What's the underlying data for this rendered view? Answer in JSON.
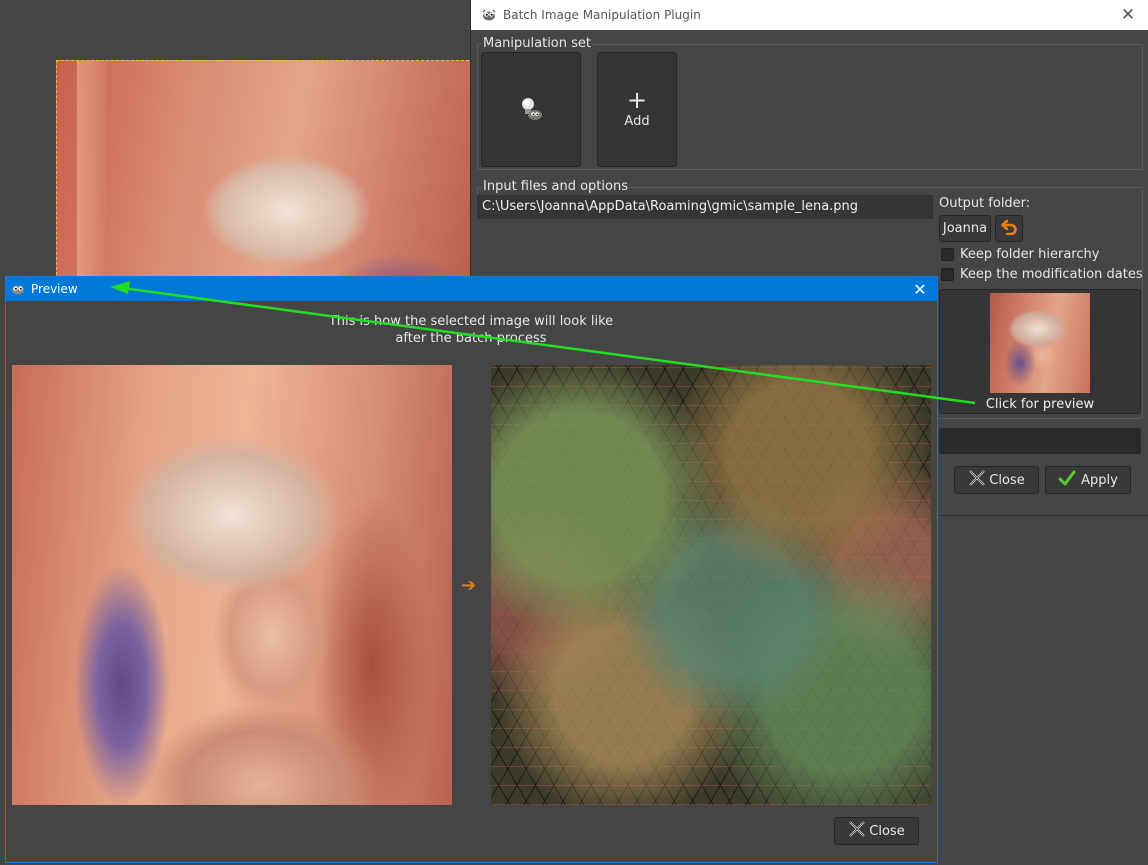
{
  "bimp": {
    "title": "Batch Image Manipulation Plugin",
    "close_glyph": "✕",
    "manipulation_set_label": "Manipulation set",
    "add_glyph": "+",
    "add_label": "Add",
    "input_files_label": "Input files and options",
    "files": [
      "C:\\Users\\Joanna\\AppData\\Roaming\\gmic\\sample_lena.png"
    ],
    "output_folder_label": "Output folder:",
    "output_folder_value": "Joanna",
    "keep_hierarchy_label": "Keep folder hierarchy",
    "keep_dates_label": "Keep the modification dates",
    "preview_label": "Click for preview",
    "close_button": "Close",
    "apply_button": "Apply"
  },
  "preview": {
    "title": "Preview",
    "close_glyph": "✕",
    "caption_line1": "This is how the selected image will look like",
    "caption_line2": "after the batch process",
    "arrow_glyph": "➔",
    "close_button": "Close"
  },
  "colors": {
    "accent_blue": "#0078d7",
    "annotation_green": "#22dd22",
    "apply_check": "#5ac92f",
    "arrow_orange": "#e87d16"
  },
  "icons": [
    "gimp-icon",
    "bulb-icon",
    "plus-icon",
    "undo-icon",
    "x-icon",
    "check-icon",
    "arrow-right-icon"
  ]
}
